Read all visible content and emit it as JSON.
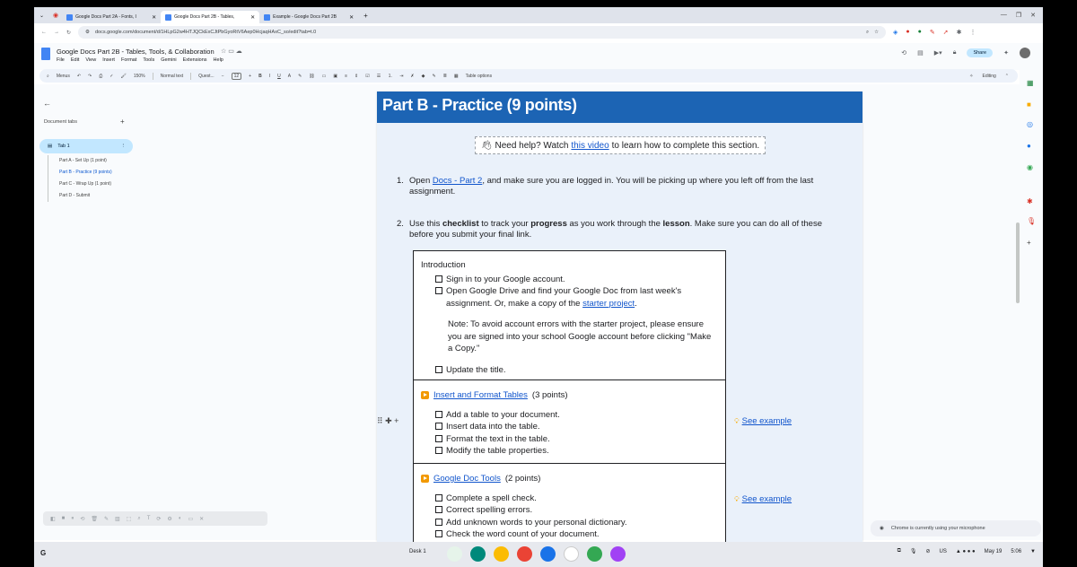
{
  "browser": {
    "tabs": [
      {
        "title": "Google Docs Part 2A - Fonts, I",
        "active": false
      },
      {
        "title": "Google Docs Part 2B - Tables,",
        "active": true
      },
      {
        "title": "Example - Google Docs Part 2B",
        "active": false
      }
    ],
    "new_tab_icon": "+",
    "url": "docs.google.com/document/d/1HLpG2w4HTJQCkExCJtPbGyoRtV6Aep0HcjaqHAxC_so/edit?tab=t.0"
  },
  "doc": {
    "title": "Google Docs Part 2B - Tables, Tools, & Collaboration",
    "menus": [
      "File",
      "Edit",
      "View",
      "Insert",
      "Format",
      "Tools",
      "Gemini",
      "Extensions",
      "Help"
    ],
    "share_label": "Share"
  },
  "toolbar": {
    "menus_label": "Menus",
    "zoom": "150%",
    "style": "Normal text",
    "font": "Quest...",
    "font_size": "12",
    "table_options": "Table options",
    "mode": "Editing"
  },
  "sidebar": {
    "header": "Document tabs",
    "tab_name": "Tab 1",
    "outline": [
      "Part A - Set Up (1 point)",
      "Part B - Practice (9 points)",
      "Part C - Wrap Up (1 point)",
      "Part D - Submit"
    ]
  },
  "page": {
    "heading": "Part B - Practice (9 points)",
    "help": {
      "pre": "Need help? Watch",
      "link": "this video",
      "post": "to learn how to complete this section."
    },
    "item1": {
      "num": "1.",
      "a": "Open",
      "link": "Docs - Part 2",
      "b": ", and make sure you are logged in. You will be picking up where you left off from the last assignment."
    },
    "item2": {
      "num": "2.",
      "a": "Use this",
      "b1": "checklist",
      "c": "to track your",
      "b2": "progress",
      "d": "as you work through the",
      "b3": "lesson",
      "e": ". Make sure you can do all of these before you submit your final link."
    },
    "checklist": {
      "intro_title": "Introduction",
      "intro_1": "Sign in to your Google account.",
      "intro_2a": "Open Google Drive and find your Google Doc from last week's assignment. Or, make a copy of the",
      "intro_2link": "starter project",
      "intro_note": "Note: To avoid account errors with the starter project, please ensure you are signed into your school Google account before clicking \"Make a Copy.\"",
      "intro_3": "Update the title.",
      "s1_link": "Insert and Format Tables",
      "s1_points": "(3 points)",
      "s1_items": [
        "Add a table to your document.",
        "Insert data into the table.",
        "Format the text in the table.",
        "Modify the table properties."
      ],
      "s2_link": "Google Doc Tools",
      "s2_points": "(2 points)",
      "s2_items": [
        "Complete a spell check.",
        "Correct spelling errors.",
        "Add unknown words to your personal dictionary.",
        "Check the word count of your document."
      ],
      "see_example": "See example"
    }
  },
  "toast": "Chrome is currently using your microphone",
  "shelf": {
    "desk": "Desk 1",
    "locale": "US",
    "date": "May 19",
    "time": "5:06"
  }
}
